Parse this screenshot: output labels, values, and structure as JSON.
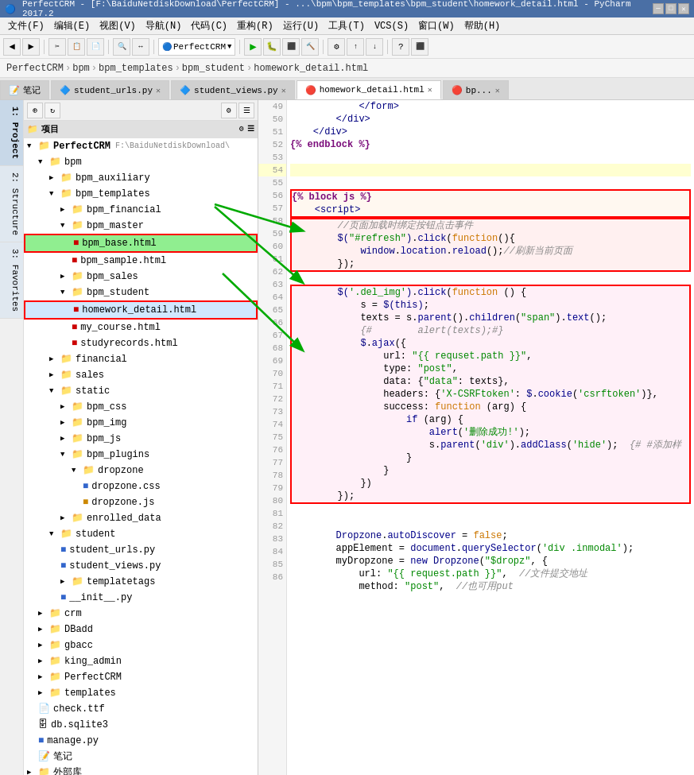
{
  "titleBar": {
    "text": "PerfectCRM - [F:\\BaiduNetdiskDownload\\PerfectCRM] - ...\\bpm\\bpm_templates\\bpm_student\\homework_detail.html - PyCharm 2017.2"
  },
  "menuBar": {
    "items": [
      "文件(F)",
      "编辑(E)",
      "视图(V)",
      "导航(N)",
      "代码(C)",
      "重构(R)",
      "运行(U)",
      "工具(T)",
      "VCS(S)",
      "窗口(W)",
      "帮助(H)"
    ]
  },
  "breadcrumb": {
    "items": [
      "PerfectCRM",
      "bpm",
      "bpm_templates",
      "bpm_student",
      "homework_detail.html"
    ]
  },
  "tabs": [
    {
      "label": "笔记",
      "active": false,
      "closable": false
    },
    {
      "label": "student_urls.py",
      "active": false,
      "closable": true
    },
    {
      "label": "student_views.py",
      "active": false,
      "closable": true
    },
    {
      "label": "homework_detail.html",
      "active": true,
      "closable": true
    },
    {
      "label": "bp...",
      "active": false,
      "closable": true
    }
  ],
  "sidebar": {
    "toolbar": {
      "buttons": [
        "⊕",
        "↻",
        "⚙",
        "☰"
      ]
    },
    "tree": [
      {
        "id": "project-root",
        "level": 0,
        "label": "项目",
        "icon": "📁",
        "arrow": "▼",
        "indent": 0
      },
      {
        "id": "perfectcrm",
        "level": 1,
        "label": "PerfectCRM F:\\BaiduNetdiskDownload\\",
        "icon": "📁",
        "arrow": "▼",
        "indent": 8
      },
      {
        "id": "bpm",
        "level": 2,
        "label": "bpm",
        "icon": "📁",
        "arrow": "▼",
        "indent": 20
      },
      {
        "id": "bpm_auxiliary",
        "level": 3,
        "label": "bpm_auxiliary",
        "icon": "📁",
        "arrow": "▶",
        "indent": 32
      },
      {
        "id": "bpm_templates",
        "level": 3,
        "label": "bpm_templates",
        "icon": "📁",
        "arrow": "▼",
        "indent": 32
      },
      {
        "id": "bpm_financial",
        "level": 4,
        "label": "bpm_financial",
        "icon": "📁",
        "arrow": "▶",
        "indent": 44
      },
      {
        "id": "bpm_master",
        "level": 4,
        "label": "bpm_master",
        "icon": "📁",
        "arrow": "▼",
        "indent": 44
      },
      {
        "id": "bpm_base_html",
        "level": 5,
        "label": "bpm_base.html",
        "icon": "🔴",
        "arrow": "",
        "indent": 56,
        "highlight": true
      },
      {
        "id": "bpm_sample_html",
        "level": 5,
        "label": "bpm_sample.html",
        "icon": "🔴",
        "arrow": "",
        "indent": 56
      },
      {
        "id": "bpm_sales",
        "level": 4,
        "label": "bpm_sales",
        "icon": "📁",
        "arrow": "▶",
        "indent": 44
      },
      {
        "id": "bpm_student",
        "level": 4,
        "label": "bpm_student",
        "icon": "📁",
        "arrow": "▼",
        "indent": 44
      },
      {
        "id": "homework_detail_html",
        "level": 5,
        "label": "homework_detail.html",
        "icon": "🔴",
        "arrow": "",
        "indent": 56,
        "selected": true
      },
      {
        "id": "my_course_html",
        "level": 5,
        "label": "my_course.html",
        "icon": "🔴",
        "arrow": "",
        "indent": 56
      },
      {
        "id": "studyrecords_html",
        "level": 5,
        "label": "studyrecords.html",
        "icon": "🔴",
        "arrow": "",
        "indent": 56
      },
      {
        "id": "financial",
        "level": 3,
        "label": "financial",
        "icon": "📁",
        "arrow": "▶",
        "indent": 32
      },
      {
        "id": "sales",
        "level": 3,
        "label": "sales",
        "icon": "📁",
        "arrow": "▶",
        "indent": 32
      },
      {
        "id": "static",
        "level": 3,
        "label": "static",
        "icon": "📁",
        "arrow": "▼",
        "indent": 32
      },
      {
        "id": "bpm_css",
        "level": 4,
        "label": "bpm_css",
        "icon": "📁",
        "arrow": "▶",
        "indent": 44
      },
      {
        "id": "bpm_img",
        "level": 4,
        "label": "bpm_img",
        "icon": "📁",
        "arrow": "▶",
        "indent": 44
      },
      {
        "id": "bpm_js",
        "level": 4,
        "label": "bpm_js",
        "icon": "📁",
        "arrow": "▶",
        "indent": 44
      },
      {
        "id": "bpm_plugins",
        "level": 4,
        "label": "bpm_plugins",
        "icon": "📁",
        "arrow": "▼",
        "indent": 44
      },
      {
        "id": "dropzone",
        "level": 5,
        "label": "dropzone",
        "icon": "📁",
        "arrow": "▼",
        "indent": 56
      },
      {
        "id": "dropzone_css",
        "level": 6,
        "label": "dropzone.css",
        "icon": "🔷",
        "arrow": "",
        "indent": 68
      },
      {
        "id": "dropzone_js",
        "level": 6,
        "label": "dropzone.js",
        "icon": "🔶",
        "arrow": "",
        "indent": 68
      },
      {
        "id": "enrolled_data",
        "level": 4,
        "label": "enrolled_data",
        "icon": "📁",
        "arrow": "▶",
        "indent": 44
      },
      {
        "id": "student",
        "level": 3,
        "label": "student",
        "icon": "📁",
        "arrow": "▼",
        "indent": 32
      },
      {
        "id": "student_urls_py",
        "level": 4,
        "label": "student_urls.py",
        "icon": "🔷",
        "arrow": "",
        "indent": 44
      },
      {
        "id": "student_views_py",
        "level": 4,
        "label": "student_views.py",
        "icon": "🔷",
        "arrow": "",
        "indent": 44
      },
      {
        "id": "templatetags",
        "level": 4,
        "label": "templatetags",
        "icon": "📁",
        "arrow": "▶",
        "indent": 44
      },
      {
        "id": "init_py",
        "level": 4,
        "label": "__init__.py",
        "icon": "🔷",
        "arrow": "",
        "indent": 44
      },
      {
        "id": "crm",
        "level": 2,
        "label": "crm",
        "icon": "📁",
        "arrow": "▶",
        "indent": 20
      },
      {
        "id": "dbadd",
        "level": 2,
        "label": "DBadd",
        "icon": "📁",
        "arrow": "▶",
        "indent": 20
      },
      {
        "id": "gbacc",
        "level": 2,
        "label": "gbacc",
        "icon": "📁",
        "arrow": "▶",
        "indent": 20
      },
      {
        "id": "king_admin",
        "level": 2,
        "label": "king_admin",
        "icon": "📁",
        "arrow": "▶",
        "indent": 20
      },
      {
        "id": "perfectcrm2",
        "level": 2,
        "label": "PerfectCRM",
        "icon": "📁",
        "arrow": "▶",
        "indent": 20
      },
      {
        "id": "templates",
        "level": 2,
        "label": "templates",
        "icon": "📁",
        "arrow": "▶",
        "indent": 20
      },
      {
        "id": "check_ttf",
        "level": 2,
        "label": "check.ttf",
        "icon": "📄",
        "arrow": "",
        "indent": 20
      },
      {
        "id": "db_sqlite3",
        "level": 2,
        "label": "db.sqlite3",
        "icon": "🗄",
        "arrow": "",
        "indent": 20
      },
      {
        "id": "manage_py",
        "level": 2,
        "label": "manage.py",
        "icon": "🔷",
        "arrow": "",
        "indent": 20
      },
      {
        "id": "note",
        "level": 2,
        "label": "笔记",
        "icon": "📝",
        "arrow": "",
        "indent": 20
      }
    ]
  },
  "leftPanel": {
    "tabs": [
      "1: Project",
      "2: Structure",
      "3: Favorites"
    ]
  },
  "codeLines": [
    {
      "num": 49,
      "content": "            </form>",
      "type": "normal"
    },
    {
      "num": 50,
      "content": "        </div>",
      "type": "normal"
    },
    {
      "num": 51,
      "content": "    </div>",
      "type": "normal"
    },
    {
      "num": 52,
      "content": "{% endblock %}",
      "type": "normal"
    },
    {
      "num": 53,
      "content": "",
      "type": "normal"
    },
    {
      "num": 54,
      "content": "",
      "type": "current"
    },
    {
      "num": 55,
      "content": "",
      "type": "normal"
    },
    {
      "num": 56,
      "content": "{% block js %}",
      "type": "box1-start"
    },
    {
      "num": 57,
      "content": "    <script>",
      "type": "box1-end"
    },
    {
      "num": 58,
      "content": "        //页面加载时绑定按钮点击事件",
      "type": "box2-start"
    },
    {
      "num": 59,
      "content": "        $(\"#refresh\").click(function(){",
      "type": "box2"
    },
    {
      "num": 60,
      "content": "            window.location.reload();//刷新当前页面",
      "type": "box2"
    },
    {
      "num": 61,
      "content": "        });",
      "type": "box2-end"
    },
    {
      "num": 62,
      "content": "",
      "type": "normal"
    },
    {
      "num": 63,
      "content": "        $('.del_img').click(function () {",
      "type": "box3-start"
    },
    {
      "num": 64,
      "content": "            s = $(this);",
      "type": "box3"
    },
    {
      "num": 65,
      "content": "            texts = s.parent().children(\"span\").text();",
      "type": "box3"
    },
    {
      "num": 66,
      "content": "            {#        alert(texts);#}",
      "type": "box3"
    },
    {
      "num": 67,
      "content": "            $.ajax({",
      "type": "box3"
    },
    {
      "num": 68,
      "content": "                url: \"{{ requset.path }}\",",
      "type": "box3"
    },
    {
      "num": 69,
      "content": "                type: \"post\",",
      "type": "box3"
    },
    {
      "num": 70,
      "content": "                data: {\"data\": texts},",
      "type": "box3"
    },
    {
      "num": 71,
      "content": "                headers: {'X-CSRFtoken': $.cookie('csrftoken')},",
      "type": "box3"
    },
    {
      "num": 72,
      "content": "                success: function (arg) {",
      "type": "box3"
    },
    {
      "num": 73,
      "content": "                    if (arg) {",
      "type": "box3"
    },
    {
      "num": 74,
      "content": "                        alert('删除成功!');",
      "type": "box3"
    },
    {
      "num": 75,
      "content": "                        s.parent('div').addClass('hide');  {# #添加样",
      "type": "box3"
    },
    {
      "num": 76,
      "content": "                    }",
      "type": "box3"
    },
    {
      "num": 77,
      "content": "                }",
      "type": "box3"
    },
    {
      "num": 78,
      "content": "            })",
      "type": "box3"
    },
    {
      "num": 79,
      "content": "        });",
      "type": "box3-end"
    },
    {
      "num": 80,
      "content": "",
      "type": "normal"
    },
    {
      "num": 81,
      "content": "",
      "type": "normal"
    },
    {
      "num": 82,
      "content": "        Dropzone.autoDiscover = false;",
      "type": "normal"
    },
    {
      "num": 83,
      "content": "        appElement = document.querySelector('div .inmodal');",
      "type": "normal"
    },
    {
      "num": 84,
      "content": "        myDropzone = new Dropzone(\"$dropz\", {",
      "type": "normal"
    },
    {
      "num": 85,
      "content": "            url: \"{{ request.path }}\",  //文件提交地址",
      "type": "normal"
    },
    {
      "num": 86,
      "content": "            method: \"post\",  //也可用put",
      "type": "normal"
    }
  ],
  "annotations": {
    "box1": {
      "label": "{% block js %} box"
    },
    "box2": {
      "label": "refresh click box"
    },
    "box3": {
      "label": "del_img click box"
    },
    "arrows": [
      {
        "from": "bpm_base_html",
        "to": "box1"
      },
      {
        "from": "homework_detail_html",
        "to": "box3"
      },
      {
        "from": "bpm_base_html",
        "to": "box2"
      }
    ]
  },
  "externalLibraries": {
    "label": "外部库"
  }
}
